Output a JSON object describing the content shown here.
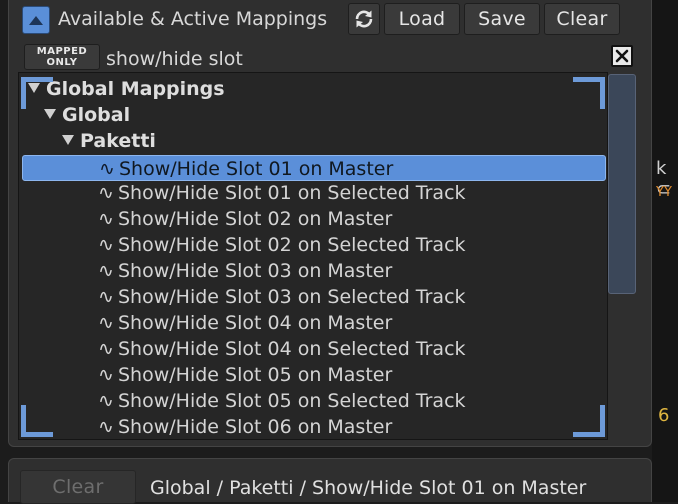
{
  "header": {
    "title": "Available & Active Mappings",
    "load_label": "Load",
    "save_label": "Save",
    "clear_label": "Clear"
  },
  "filter": {
    "mapped_only_line1": "MAPPED",
    "mapped_only_line2": "ONLY",
    "search_value": "show/hide slot"
  },
  "tree": {
    "groups": [
      {
        "label": "Global Mappings"
      },
      {
        "label": "Global"
      },
      {
        "label": "Paketti"
      }
    ],
    "items": [
      {
        "label": "Show/Hide Slot 01 on Master",
        "selected": true
      },
      {
        "label": "Show/Hide Slot 01 on Selected Track"
      },
      {
        "label": "Show/Hide Slot 02 on Master"
      },
      {
        "label": "Show/Hide Slot 02 on Selected Track"
      },
      {
        "label": "Show/Hide Slot 03 on Master"
      },
      {
        "label": "Show/Hide Slot 03 on Selected Track"
      },
      {
        "label": "Show/Hide Slot 04 on Master"
      },
      {
        "label": "Show/Hide Slot 04 on Selected Track"
      },
      {
        "label": "Show/Hide Slot 05 on Master"
      },
      {
        "label": "Show/Hide Slot 05 on Selected Track"
      },
      {
        "label": "Show/Hide Slot 06 on Master"
      }
    ],
    "item_glyph": "∿"
  },
  "status": {
    "clear_label": "Clear",
    "path": "Global / Paketti / Show/Hide Slot 01 on Master"
  },
  "right_edge": {
    "frag1": "k ⊂",
    "frag2": "ΥΥ",
    "frag3": "6"
  },
  "colors": {
    "accent": "#5b8fd9",
    "panel": "#2f2f2f",
    "background": "#1c1c1c"
  }
}
